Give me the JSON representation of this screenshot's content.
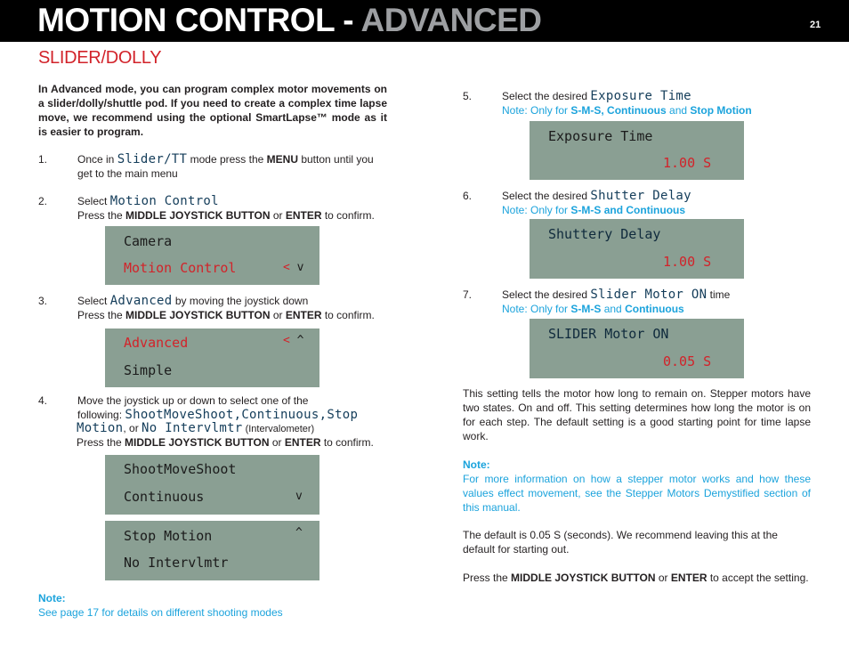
{
  "header": {
    "title_main": "MOTION CONTROL - ",
    "title_accent": "ADVANCED",
    "page_number": "21"
  },
  "section_title": "SLIDER/DOLLY",
  "intro": "In Advanced mode, you can program complex motor movements on a slider/dolly/shuttle pod. If you need to create a complex time lapse move, we recommend using the optional SmartLapse™ mode as it is easier to program.",
  "steps": {
    "s1": {
      "num": "1.",
      "pre": "Once in ",
      "lcd_word": "Slider/TT",
      "mid": "  mode press the ",
      "bold": "MENU",
      "post": " button until you",
      "line2": "get to the main menu"
    },
    "s2": {
      "num": "2.",
      "pre": "Select ",
      "lcd_word": "Motion Control",
      "confirm_pre": "Press the ",
      "confirm_bold1": "MIDDLE JOYSTICK BUTTON",
      "confirm_or": " or ",
      "confirm_bold2": "ENTER",
      "confirm_post": " to confirm.",
      "screen": {
        "line1": "Camera",
        "line2": "Motion Control",
        "mark_lt": "<",
        "mark_arrow": "v"
      }
    },
    "s3": {
      "num": "3.",
      "pre": "Select ",
      "lcd_word": "Advanced",
      "post": " by moving the joystick down",
      "confirm_pre": "Press the ",
      "confirm_bold1": "MIDDLE JOYSTICK BUTTON",
      "confirm_or": " or ",
      "confirm_bold2": "ENTER",
      "confirm_post": " to confirm.",
      "screen": {
        "line1": "Advanced",
        "line2": "Simple",
        "mark_lt": "<",
        "mark_arrow": "^"
      }
    },
    "s4": {
      "num": "4.",
      "line1": "Move the joystick up or down to select one of the",
      "following": "following: ",
      "opt1": "ShootMoveShoot",
      "comma": ",",
      "opt2": "Continuous",
      "opt3a": "Stop",
      "opt3b": "Motion",
      "or": ", or ",
      "opt4": "No Intervlmtr",
      "paren": " (Intervalometer)",
      "confirm_pre": "Press the ",
      "confirm_bold1": "MIDDLE JOYSTICK BUTTON",
      "confirm_or": " or ",
      "confirm_bold2": "ENTER",
      "confirm_post": " to confirm.",
      "screen_a": {
        "line1": "ShootMoveShoot",
        "line2": "Continuous",
        "mark_arrow": "v"
      },
      "screen_b": {
        "line1": "Stop Motion",
        "line2": "No Intervlmtr",
        "mark_arrow": "^"
      }
    },
    "s5": {
      "num": "5.",
      "pre": "Select the desired ",
      "lcd_word": "Exposure Time",
      "note_pre": "Note: Only for ",
      "note_bold1": "S-M-S, Continuous",
      "note_and": " and ",
      "note_bold2": "Stop Motion",
      "screen": {
        "line1": "Exposure Time",
        "value": "1.00 S"
      }
    },
    "s6": {
      "num": "6.",
      "pre": "Select the desired ",
      "lcd_word": "Shutter Delay",
      "note_pre": "Note: Only for ",
      "note_bold1": "S-M-S and Continuous",
      "screen": {
        "line1": "Shuttery Delay",
        "value": "1.00 S"
      }
    },
    "s7": {
      "num": "7.",
      "pre": "Select the desired ",
      "lcd_word": "Slider Motor ON",
      "post": "  time",
      "note_pre": "Note: Only for ",
      "note_bold1": "S-M-S",
      "note_and": " and ",
      "note_bold2": "Continuous",
      "screen": {
        "line1": "SLIDER Motor ON",
        "value": "0.05 S"
      }
    }
  },
  "left_note": {
    "label": "Note:",
    "text": "See page 17 for details on different shooting modes"
  },
  "right": {
    "para1": "This setting tells the motor how long to remain on. Stepper motors have two states. On and off. This setting determines how long the motor is on for each step. The default setting is a good starting point for time lapse work.",
    "note_label": "Note:",
    "note_text": "For more information on how a stepper motor works and how these values effect movement, see the Stepper Motors Demystified section of this manual.",
    "para2": "The default is 0.05 S (seconds). We recommend leaving this at the default for starting out.",
    "para3_pre": "Press the ",
    "para3_bold1": "MIDDLE JOYSTICK BUTTON",
    "para3_or": " or ",
    "para3_bold2": "ENTER",
    "para3_post": " to accept the setting."
  },
  "colors": {
    "header_bg": "#000000",
    "accent_red": "#d2232a",
    "accent_gray": "#9d9fa2",
    "note_blue": "#1ba3dc",
    "lcd_bg": "#8a9f93",
    "lcd_word": "#143d5a"
  }
}
